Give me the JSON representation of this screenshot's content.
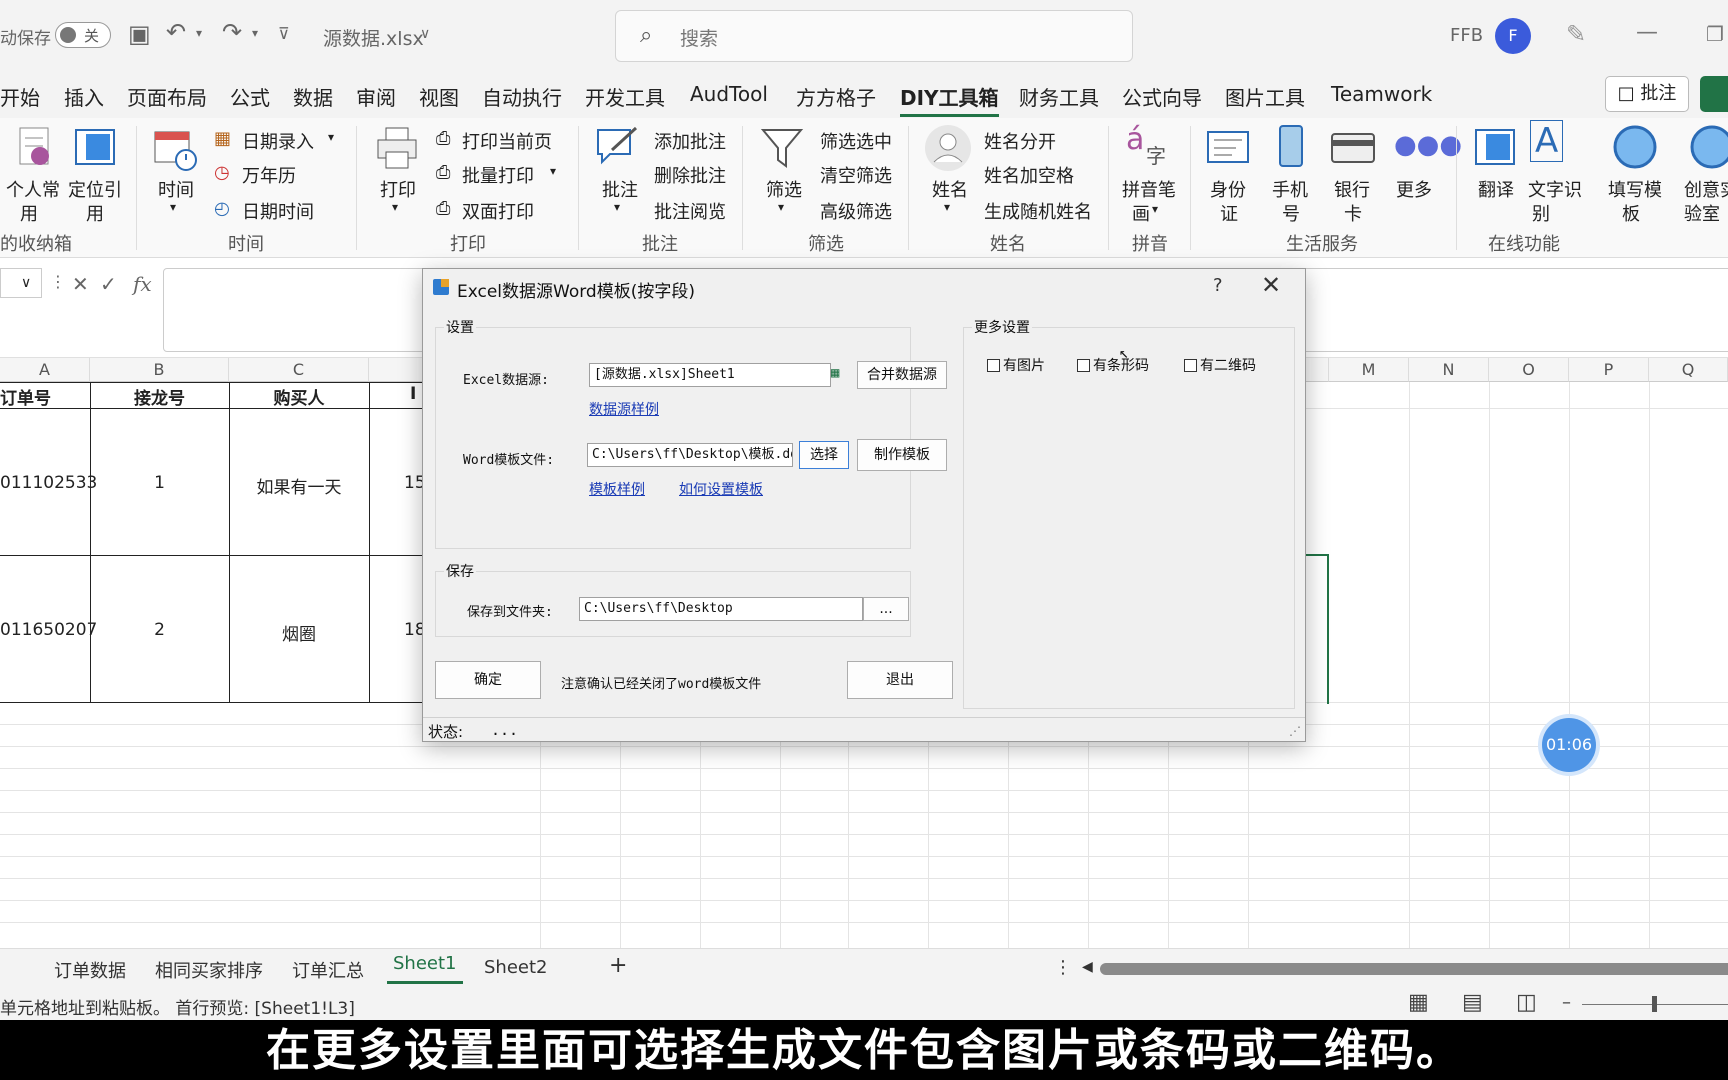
{
  "titlebar": {
    "autosave_label": "动保存",
    "autosave_state": "关",
    "filename": "源数据.xlsx",
    "search_placeholder": "搜索",
    "user_initials": "FFB",
    "avatar_letter": "F"
  },
  "menu": {
    "tabs": [
      "开始",
      "插入",
      "页面布局",
      "公式",
      "数据",
      "审阅",
      "视图",
      "自动执行",
      "开发工具",
      "AudTool",
      "方方格子",
      "DIY工具箱",
      "财务工具",
      "公式向导",
      "图片工具",
      "Teamwork"
    ],
    "active_tab": "DIY工具箱",
    "comment_button": "批注"
  },
  "ribbon": {
    "group_favorites": {
      "name": "的收纳箱",
      "btn1": "个人常用",
      "btn1_l1": "个人常",
      "btn1_l2": "用",
      "btn2_l1": "定位引",
      "btn2_l2": "用"
    },
    "group_time": {
      "name": "时间",
      "big": "时间",
      "items": [
        "日期录入",
        "万年历",
        "日期时间"
      ]
    },
    "group_print": {
      "name": "打印",
      "big": "打印",
      "items": [
        "打印当前页",
        "批量打印",
        "双面打印"
      ]
    },
    "group_comment": {
      "name": "批注",
      "big": "批注",
      "items": [
        "添加批注",
        "删除批注",
        "批注阅览"
      ]
    },
    "group_filter": {
      "name": "筛选",
      "big": "筛选",
      "items": [
        "筛选选中",
        "清空筛选",
        "高级筛选"
      ]
    },
    "group_name": {
      "name": "姓名",
      "big": "姓名",
      "items": [
        "姓名分开",
        "姓名加空格",
        "生成随机姓名"
      ]
    },
    "group_pinyin": {
      "name": "拼音",
      "l1": "拼音笔",
      "l2": "画"
    },
    "group_life": {
      "name": "生活服务",
      "id_l1": "身份",
      "id_l2": "证",
      "phone_l1": "手机",
      "phone_l2": "号",
      "bank_l1": "银行",
      "bank_l2": "卡",
      "more": "更多"
    },
    "group_online": {
      "name": "在线功能",
      "translate": "翻译",
      "ocr_l1": "文字识",
      "ocr_l2": "别",
      "template_l1": "填写模",
      "template_l2": "板",
      "lab_l1": "创意实",
      "lab_l2": "验室"
    }
  },
  "formula_bar": {
    "fx": "fx"
  },
  "grid": {
    "columns": [
      "A",
      "B",
      "C",
      "M",
      "N",
      "O",
      "P",
      "Q"
    ],
    "headers": [
      "订单号",
      "接龙号",
      "购买人",
      "I"
    ],
    "rows": [
      {
        "order": "011102533",
        "num": "1",
        "buyer": "如果有一天",
        "d": "15"
      },
      {
        "order": "011650207",
        "num": "2",
        "buyer": "烟圈",
        "d": "18"
      }
    ]
  },
  "dialog": {
    "title": "Excel数据源Word模板(按字段)",
    "help": "?",
    "close": "✕",
    "settings_legend": "设置",
    "excel_source_label": "Excel数据源:",
    "excel_source_value": "[源数据.xlsx]Sheet1",
    "merge_button": "合并数据源",
    "source_sample_link": "数据源样例",
    "word_template_label": "Word模板文件:",
    "word_template_value": "C:\\Users\\ff\\Desktop\\模板.docx",
    "choose_button": "选择",
    "make_template_button": "制作模板",
    "template_sample_link": "模板样例",
    "how_to_link": "如何设置模板",
    "save_legend": "保存",
    "save_folder_label": "保存到文件夹:",
    "save_folder_value": "C:\\Users\\ff\\Desktop",
    "browse_button": "...",
    "ok_button": "确定",
    "note": "注意确认已经关闭了word模板文件",
    "exit_button": "退出",
    "more_legend": "更多设置",
    "chk_image": "有图片",
    "chk_barcode": "有条形码",
    "chk_qrcode": "有二维码",
    "status_label": "状态:",
    "status_value": "..."
  },
  "sheets": {
    "tabs": [
      "订单数据",
      "相同买家排序",
      "订单汇总",
      "Sheet1",
      "Sheet2"
    ],
    "active": "Sheet1",
    "add": "+"
  },
  "status": {
    "text": "单元格地址到粘贴板。 首行预览: [Sheet1!L3]"
  },
  "timer": "01:06",
  "subtitle": "在更多设置里面可选择生成文件包含图片或条码或二维码。"
}
